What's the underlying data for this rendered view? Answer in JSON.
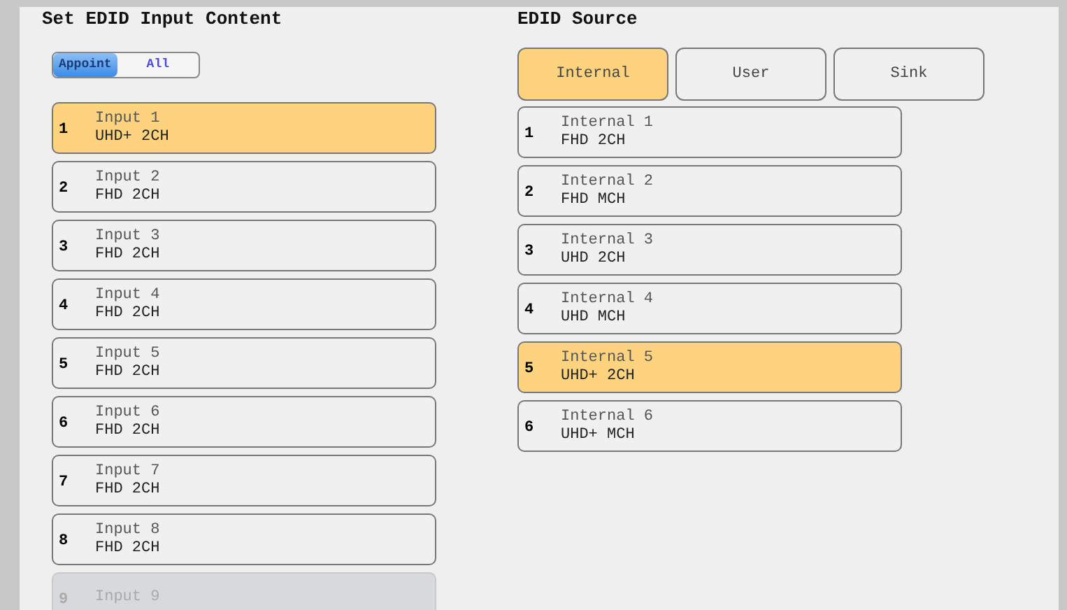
{
  "input_panel": {
    "title": "Set EDID Input Content",
    "mode_toggle": [
      {
        "label": "Appoint",
        "selected": true
      },
      {
        "label": "All",
        "selected": false
      }
    ],
    "inputs": [
      {
        "number": "1",
        "name": "Input 1",
        "edid": "UHD+ 2CH",
        "selected": true,
        "disabled": false
      },
      {
        "number": "2",
        "name": "Input 2",
        "edid": "FHD 2CH",
        "selected": false,
        "disabled": false
      },
      {
        "number": "3",
        "name": "Input 3",
        "edid": "FHD 2CH",
        "selected": false,
        "disabled": false
      },
      {
        "number": "4",
        "name": "Input 4",
        "edid": "FHD 2CH",
        "selected": false,
        "disabled": false
      },
      {
        "number": "5",
        "name": "Input 5",
        "edid": "FHD 2CH",
        "selected": false,
        "disabled": false
      },
      {
        "number": "6",
        "name": "Input 6",
        "edid": "FHD 2CH",
        "selected": false,
        "disabled": false
      },
      {
        "number": "7",
        "name": "Input 7",
        "edid": "FHD 2CH",
        "selected": false,
        "disabled": false
      },
      {
        "number": "8",
        "name": "Input 8",
        "edid": "FHD 2CH",
        "selected": false,
        "disabled": false
      },
      {
        "number": "9",
        "name": "Input 9",
        "selected": false,
        "disabled": true
      }
    ]
  },
  "source_panel": {
    "title": "EDID Source",
    "tabs": [
      {
        "label": "Internal",
        "selected": true
      },
      {
        "label": "User",
        "selected": false
      },
      {
        "label": "Sink",
        "selected": false
      }
    ],
    "sources": [
      {
        "number": "1",
        "name": "Internal 1",
        "edid": "FHD 2CH",
        "selected": false
      },
      {
        "number": "2",
        "name": "Internal 2",
        "edid": "FHD MCH",
        "selected": false
      },
      {
        "number": "3",
        "name": "Internal 3",
        "edid": "UHD 2CH",
        "selected": false
      },
      {
        "number": "4",
        "name": "Internal 4",
        "edid": "UHD MCH",
        "selected": false
      },
      {
        "number": "5",
        "name": "Internal 5",
        "edid": "UHD+ 2CH",
        "selected": true
      },
      {
        "number": "6",
        "name": "Internal 6",
        "edid": "UHD+ MCH",
        "selected": false
      }
    ]
  }
}
